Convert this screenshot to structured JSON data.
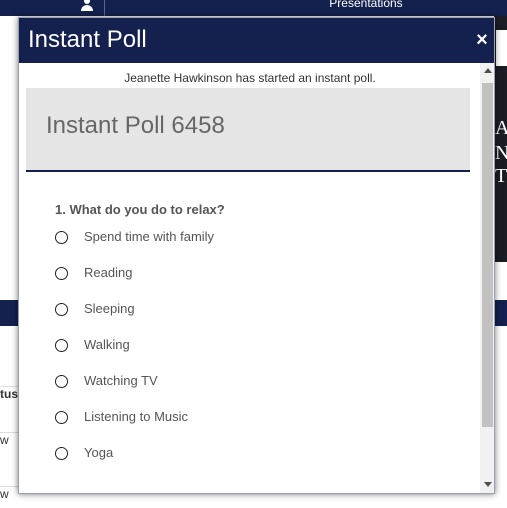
{
  "background": {
    "nav_label": "Presentations",
    "side_letters": [
      "A",
      "N",
      "T"
    ],
    "table_header": "tus",
    "table_rows": [
      "w",
      "w"
    ]
  },
  "modal": {
    "title": "Instant Poll",
    "close_symbol": "×",
    "started_message": "Jeanette Hawkinson has started an instant poll.",
    "poll_name": "Instant Poll 6458",
    "question": "1. What do you do to relax?",
    "options": [
      {
        "label": "Spend time with family",
        "selected": false
      },
      {
        "label": "Reading",
        "selected": false
      },
      {
        "label": "Sleeping",
        "selected": false
      },
      {
        "label": "Walking",
        "selected": false
      },
      {
        "label": "Watching TV",
        "selected": false
      },
      {
        "label": "Listening to Music",
        "selected": false
      },
      {
        "label": "Yoga",
        "selected": false
      }
    ]
  },
  "colors": {
    "header_navy": "#14204e",
    "banner_grey": "#e5e5e5",
    "text_grey": "#555555"
  }
}
